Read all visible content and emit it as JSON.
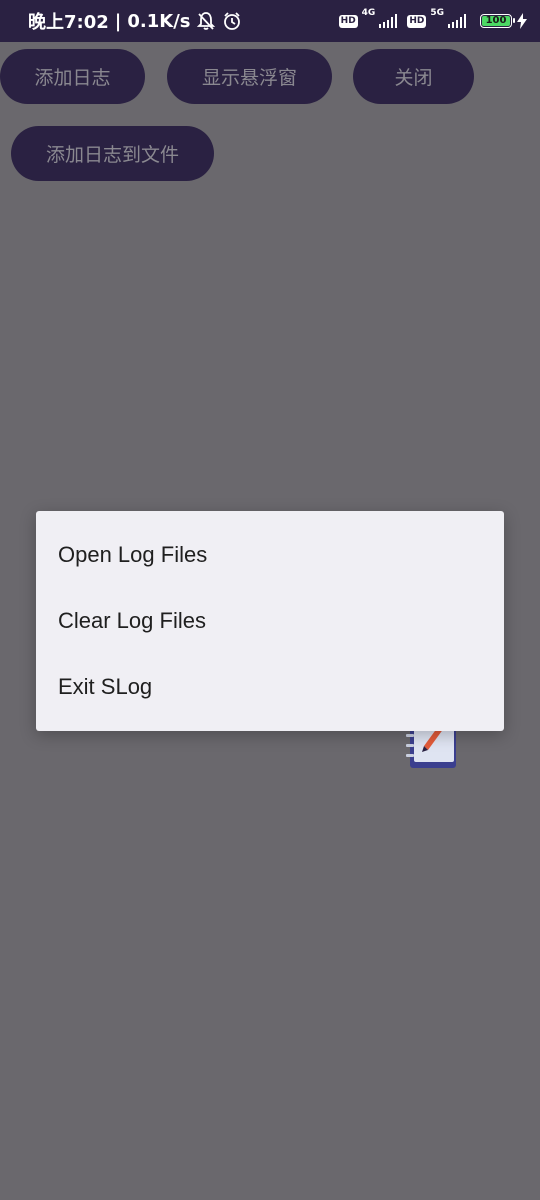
{
  "status_bar": {
    "time": "晚上7:02",
    "separator": "|",
    "net_speed": "0.1K/s",
    "icons": [
      "mute-bell-icon",
      "alarm-icon",
      "hd-icon",
      "signal-4g-icon",
      "hd-icon",
      "signal-5g-icon",
      "battery-icon",
      "charging-icon"
    ],
    "hd_label": "HD",
    "net1_label": "4G",
    "net2_label": "5G",
    "battery_level": "100"
  },
  "toolbar": {
    "add_log_label": "添加日志",
    "show_float_label": "显示悬浮窗",
    "close_label": "关闭",
    "add_log_to_file_label": "添加日志到文件"
  },
  "menu": {
    "items": [
      {
        "label": "Open Log Files"
      },
      {
        "label": "Clear Log Files"
      },
      {
        "label": "Exit SLog"
      }
    ]
  },
  "floating_icon": "notebook-pen-icon",
  "colors": {
    "accent": "#2a2142",
    "scrim": "#6a686d",
    "menu_bg": "#f0eff4",
    "button_text": "#8a8890"
  }
}
